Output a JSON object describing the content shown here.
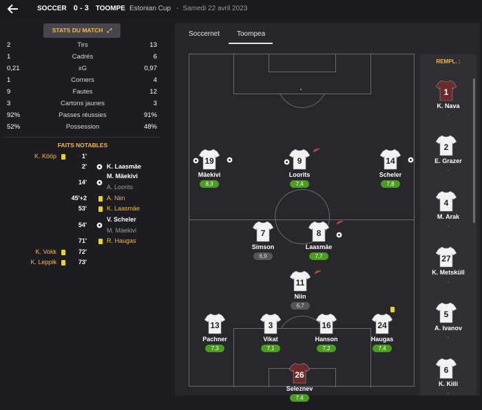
{
  "header": {
    "home": "SOCCER",
    "score": "0 - 3",
    "away": "TOOMPE",
    "competition": "Estonian Cup",
    "separator": "-",
    "date": "Samedi 22 avril 2023"
  },
  "stats": {
    "button_label": "STATS DU MATCH",
    "rows": [
      {
        "home": "2",
        "label": "Tirs",
        "away": "13"
      },
      {
        "home": "1",
        "label": "Cadrés",
        "away": "6"
      },
      {
        "home": "0,21",
        "label": "xG",
        "away": "0,97"
      },
      {
        "home": "1",
        "label": "Corners",
        "away": "4"
      },
      {
        "home": "9",
        "label": "Fautes",
        "away": "12"
      },
      {
        "home": "3",
        "label": "Cartons jaunes",
        "away": "3"
      },
      {
        "home": "92%",
        "label": "Passes réussies",
        "away": "91%"
      },
      {
        "home": "52%",
        "label": "Possession",
        "away": "48%"
      }
    ]
  },
  "events": {
    "title": "FAITS NOTABLES",
    "items": [
      {
        "minute": "1'",
        "home": "K. Kööp"
      },
      {
        "minute": "2'",
        "away": "K. Laasmäe"
      },
      {
        "minute": "14'",
        "away": "M. Mäekivi",
        "assist": "A. Loorits"
      },
      {
        "minute": "45'+2",
        "away_card": "A. Niin"
      },
      {
        "minute": "53'",
        "away_card": "K. Laasmäe"
      },
      {
        "minute": "54'",
        "away": "V. Scheler",
        "assist": "M. Mäekivi"
      },
      {
        "minute": "71'",
        "away_card": "R. Haugas"
      },
      {
        "minute": "72'",
        "home": "K. Vokk"
      },
      {
        "minute": "73'",
        "home": "K. Leppik"
      }
    ]
  },
  "tabs": [
    {
      "label": "Soccernet"
    },
    {
      "label": "Toompea"
    }
  ],
  "lineup": [
    {
      "number": "19",
      "name": "Mäekivi",
      "rating": "8,3"
    },
    {
      "number": "9",
      "name": "Loorits",
      "rating": "7,4"
    },
    {
      "number": "14",
      "name": "Scheler",
      "rating": "7,8"
    },
    {
      "number": "7",
      "name": "Simson",
      "rating": "6,9"
    },
    {
      "number": "8",
      "name": "Laasmäe",
      "rating": "7,7"
    },
    {
      "number": "11",
      "name": "Niin",
      "rating": "6,7"
    },
    {
      "number": "13",
      "name": "Pachner",
      "rating": "7,3"
    },
    {
      "number": "3",
      "name": "Vikat",
      "rating": "7,1"
    },
    {
      "number": "16",
      "name": "Hanson",
      "rating": "7,2"
    },
    {
      "number": "24",
      "name": "Haugas",
      "rating": "7,4"
    },
    {
      "number": "26",
      "name": "Seleznev",
      "rating": "7,4"
    }
  ],
  "bench": {
    "title": "REMPL. :",
    "players": [
      {
        "number": "1",
        "name": "K. Nava",
        "rating": "-"
      },
      {
        "number": "2",
        "name": "E. Grazer",
        "rating": "-"
      },
      {
        "number": "4",
        "name": "M. Arak",
        "rating": "-"
      },
      {
        "number": "27",
        "name": "K. Metsküll",
        "rating": "-"
      },
      {
        "number": "5",
        "name": "A. Ivanov",
        "rating": "-"
      },
      {
        "number": "6",
        "name": "K. Kiili",
        "rating": "-"
      }
    ]
  },
  "colors": {
    "accent": "#f4b942",
    "rating_good": "#4a9d1e",
    "yellow_card": "#f0d020",
    "kit_outfield": "#f2f2f2",
    "kit_keeper": "#6e2a2a"
  }
}
